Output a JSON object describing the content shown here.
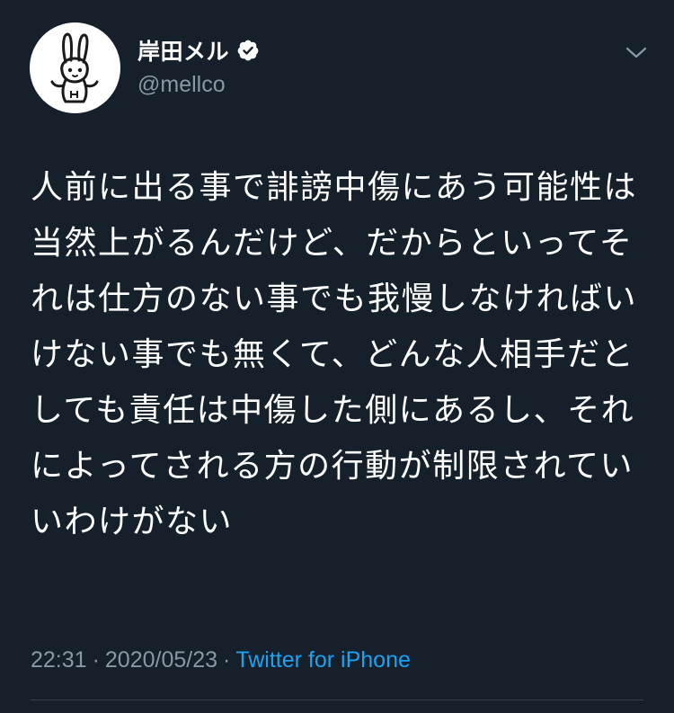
{
  "author": {
    "display_name": "岸田メル",
    "handle": "@mellco",
    "verified": true,
    "avatar": "rabbit-mascot-avatar"
  },
  "tweet": {
    "text": "人前に出る事で誹謗中傷にあう可能性は当然上がるんだけど、だからといってそれは仕方のない事でも我慢しなければいけない事でも無くて、どんな人相手だとしても責任は中傷した側にあるし、それによってされる方の行動が制限されていいわけがない"
  },
  "meta": {
    "time": "22:31",
    "separator": "·",
    "date": "2020/05/23",
    "source": "Twitter for iPhone"
  },
  "icons": {
    "verified": "verified-badge-icon",
    "caret": "chevron-down-icon"
  },
  "colors": {
    "background": "#15202b",
    "text": "#ffffff",
    "secondary": "#8899a6",
    "accent": "#1da1f2",
    "divider": "#38444d"
  }
}
